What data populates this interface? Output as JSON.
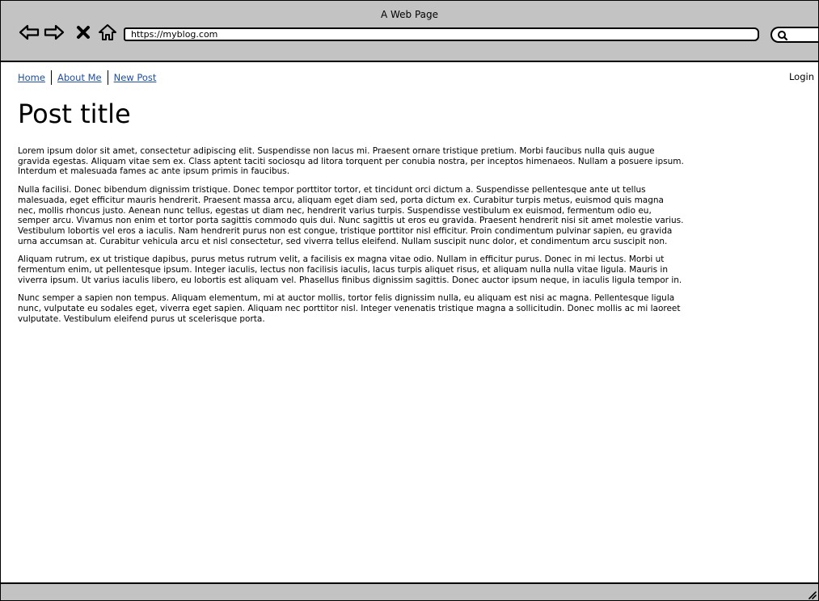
{
  "window": {
    "title": "A Web Page"
  },
  "toolbar": {
    "back_icon": "back-arrow-icon",
    "forward_icon": "forward-arrow-icon",
    "stop_icon": "close-icon",
    "home_icon": "home-icon",
    "url": "https://myblog.com",
    "search_icon": "search-icon"
  },
  "nav": {
    "links": [
      {
        "label": "Home"
      },
      {
        "label": "About Me"
      },
      {
        "label": "New Post"
      }
    ],
    "login": "Login"
  },
  "post": {
    "title": "Post title",
    "paragraphs": [
      "Lorem ipsum dolor sit amet, consectetur adipiscing elit. Suspendisse non lacus mi. Praesent ornare tristique pretium. Morbi faucibus nulla quis augue gravida egestas. Aliquam vitae sem ex. Class aptent taciti sociosqu ad litora torquent per conubia nostra, per inceptos himenaeos. Nullam a posuere ipsum. Interdum et malesuada fames ac ante ipsum primis in faucibus.",
      "Nulla facilisi. Donec bibendum dignissim tristique. Donec tempor porttitor tortor, et tincidunt orci dictum a. Suspendisse pellentesque ante ut tellus malesuada, eget efficitur mauris hendrerit. Praesent massa arcu, aliquam eget diam sed, porta dictum ex. Curabitur turpis metus, euismod quis magna nec, mollis rhoncus justo. Aenean nunc tellus, egestas ut diam nec, hendrerit varius turpis. Suspendisse vestibulum ex euismod, fermentum odio eu, semper arcu. Vivamus non enim et tortor porta sagittis commodo quis dui. Nunc sagittis ut eros eu gravida. Praesent hendrerit nisi sit amet molestie varius. Vestibulum lobortis vel eros a iaculis. Nam hendrerit purus non est congue, tristique porttitor nisl efficitur. Proin condimentum pulvinar sapien, eu gravida urna accumsan at. Curabitur vehicula arcu et nisl consectetur, sed viverra tellus eleifend. Nullam suscipit nunc dolor, et condimentum arcu suscipit non.",
      "Aliquam rutrum, ex ut tristique dapibus, purus metus rutrum velit, a facilisis ex magna vitae odio. Nullam in efficitur purus. Donec in mi lectus. Morbi ut fermentum enim, ut pellentesque ipsum. Integer iaculis, lectus non facilisis iaculis, lacus turpis aliquet risus, et aliquam nulla nulla vitae ligula. Mauris in viverra ipsum. Ut varius iaculis libero, eu lobortis est aliquam vel. Phasellus finibus dignissim sagittis. Donec auctor ipsum neque, in iaculis ligula tempor in.",
      "Nunc semper a sapien non tempus. Aliquam elementum, mi at auctor mollis, tortor felis dignissim nulla, eu aliquam est nisi ac magna. Pellentesque ligula nunc, vulputate eu sodales eget, viverra eget sapien. Aliquam nec porttitor nisl. Integer venenatis tristique magna a sollicitudin. Donec mollis ac mi laoreet vulputate. Vestibulum eleifend purus ut scelerisque porta."
    ]
  },
  "statusbar": {
    "grip_icon": "resize-grip-icon"
  }
}
